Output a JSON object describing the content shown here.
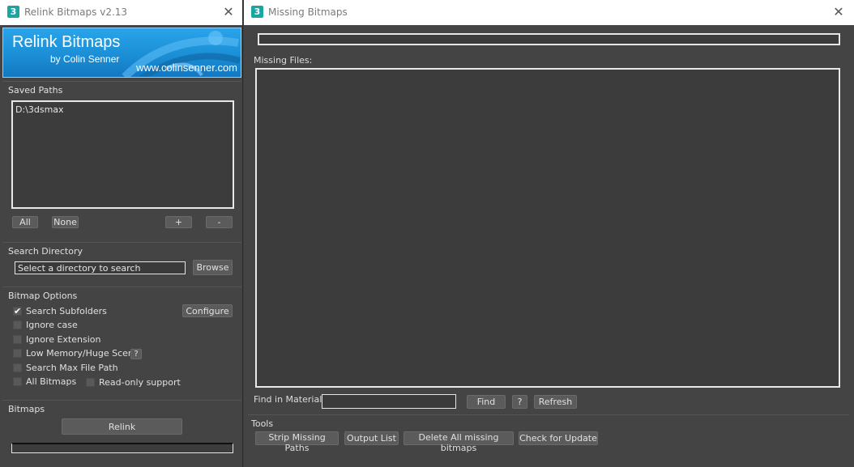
{
  "left_window": {
    "title": "Relink Bitmaps v2.13",
    "app_icon": "3",
    "banner": {
      "title": "Relink Bitmaps",
      "byline": "by Colin Senner",
      "url": "www.colinsenner.com"
    },
    "saved_paths": {
      "label": "Saved Paths",
      "items": [
        "D:\\3dsmax"
      ],
      "buttons": {
        "all": "All",
        "none": "None",
        "add": "+",
        "remove": "-"
      }
    },
    "search_directory": {
      "label": "Search Directory",
      "value": "Select a directory to search",
      "browse": "Browse"
    },
    "bitmap_options": {
      "label": "Bitmap Options",
      "configure": "Configure",
      "help": "?",
      "options": {
        "search_subfolders": {
          "label": "Search Subfolders",
          "checked": true
        },
        "ignore_case": {
          "label": "Ignore case",
          "checked": false
        },
        "ignore_extension": {
          "label": "Ignore Extension",
          "checked": false
        },
        "low_memory": {
          "label": "Low Memory/Huge Scene",
          "checked": false
        },
        "search_max_path": {
          "label": "Search Max File Path",
          "checked": false
        },
        "all_bitmaps": {
          "label": "All Bitmaps",
          "checked": false
        },
        "read_only": {
          "label": "Read-only support",
          "checked": false
        }
      }
    },
    "bitmaps": {
      "label": "Bitmaps",
      "relink": "Relink"
    }
  },
  "right_window": {
    "title": "Missing Bitmaps",
    "app_icon": "3",
    "missing_files_label": "Missing Files:",
    "find_in_material_label": "Find in Material:",
    "find_in_material_value": "",
    "find": "Find",
    "help": "?",
    "refresh": "Refresh",
    "tools": {
      "label": "Tools",
      "strip": "Strip Missing Paths",
      "output": "Output List",
      "delete_all": "Delete All missing bitmaps",
      "check_update": "Check for Update"
    }
  },
  "colors": {
    "panel_bg": "#444444",
    "banner_blue": "#1b8fd6",
    "titlebar_bg": "#ffffff",
    "accent_icon": "#1aa6a0"
  }
}
